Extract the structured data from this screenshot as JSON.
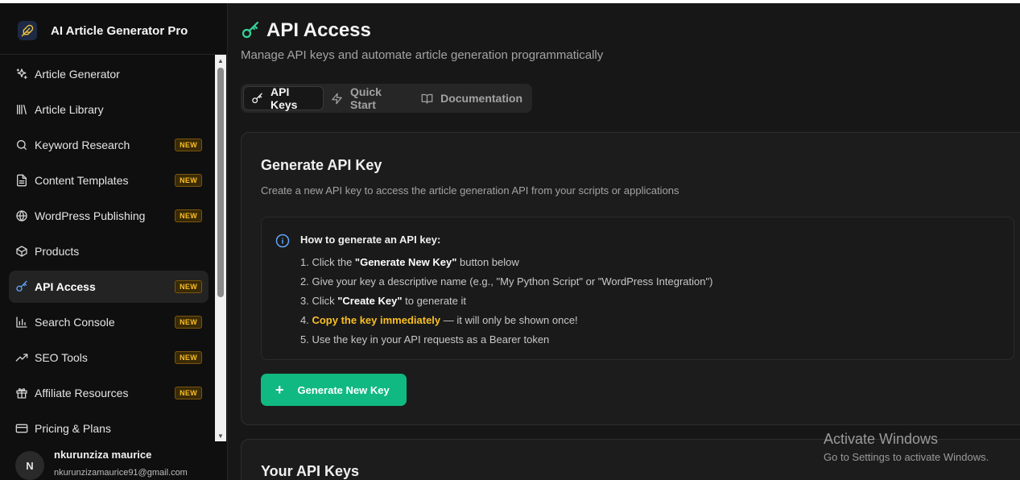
{
  "brand": {
    "title": "AI Article Generator Pro"
  },
  "sidebar": {
    "items": [
      {
        "label": "Article Generator",
        "icon": "sparkles-icon",
        "badge": ""
      },
      {
        "label": "Article Library",
        "icon": "library-icon",
        "badge": ""
      },
      {
        "label": "Keyword Research",
        "icon": "search-icon",
        "badge": "NEW"
      },
      {
        "label": "Content Templates",
        "icon": "file-text-icon",
        "badge": "NEW"
      },
      {
        "label": "WordPress Publishing",
        "icon": "globe-icon",
        "badge": "NEW"
      },
      {
        "label": "Products",
        "icon": "package-icon",
        "badge": ""
      },
      {
        "label": "API Access",
        "icon": "key-icon",
        "badge": "NEW",
        "active": true
      },
      {
        "label": "Search Console",
        "icon": "bar-chart-icon",
        "badge": "NEW"
      },
      {
        "label": "SEO Tools",
        "icon": "trending-up-icon",
        "badge": "NEW"
      },
      {
        "label": "Affiliate Resources",
        "icon": "gift-icon",
        "badge": "NEW"
      },
      {
        "label": "Pricing & Plans",
        "icon": "credit-card-icon",
        "badge": ""
      }
    ]
  },
  "user": {
    "initial": "N",
    "name": "nkurunziza maurice",
    "email": "nkurunzizamaurice91@gmail.com"
  },
  "page": {
    "title": "API Access",
    "subtitle": "Manage API keys and automate article generation programmatically"
  },
  "tabs": [
    {
      "label": "API Keys",
      "icon": "key-icon",
      "active": true
    },
    {
      "label": "Quick Start",
      "icon": "zap-icon"
    },
    {
      "label": "Documentation",
      "icon": "book-open-icon"
    }
  ],
  "generate_card": {
    "title": "Generate API Key",
    "description": "Create a new API key to access the article generation API from your scripts or applications",
    "info_heading": "How to generate an API key:",
    "steps": [
      {
        "prefix": "1. Click the ",
        "strong": "\"Generate New Key\"",
        "suffix": " button below"
      },
      {
        "prefix": "2. Give your key a descriptive name (e.g., \"My Python Script\" or \"WordPress Integration\")",
        "strong": "",
        "suffix": ""
      },
      {
        "prefix": "3. Click ",
        "strong": "\"Create Key\"",
        "suffix": " to generate it"
      },
      {
        "prefix": "4. ",
        "warn": "Copy the key immediately",
        "suffix": " — it will only be shown once!"
      },
      {
        "prefix": "5. Use the key in your API requests as a Bearer token",
        "strong": "",
        "suffix": ""
      }
    ],
    "button_label": "Generate New Key"
  },
  "keys_card": {
    "title": "Your API Keys"
  },
  "watermark": {
    "title": "Activate Windows",
    "subtitle": "Go to Settings to activate Windows."
  },
  "colors": {
    "accent": "#10b981",
    "active_icon": "#60a5fa",
    "badge_text": "#fbbf24",
    "title_icon": "#34d399"
  }
}
